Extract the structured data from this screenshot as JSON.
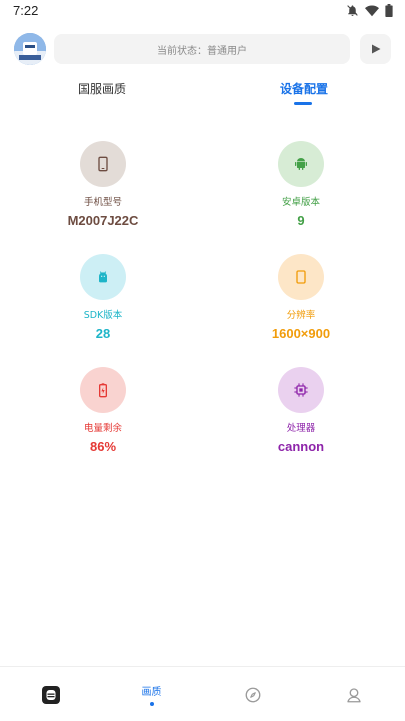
{
  "status_bar": {
    "time": "7:22"
  },
  "header": {
    "status_text": "当前状态：普通用户"
  },
  "tabs": [
    {
      "label": "国服画质",
      "active": false
    },
    {
      "label": "设备配置",
      "active": true
    }
  ],
  "device": {
    "items": [
      {
        "label": "手机型号",
        "value": "M2007J22C",
        "icon": "phone-icon",
        "color": "#6d4c41",
        "bg": "#e3dcd7"
      },
      {
        "label": "安卓版本",
        "value": "9",
        "icon": "android-icon",
        "color": "#43a047",
        "bg": "#d7ecd5"
      },
      {
        "label": "SDK版本",
        "value": "28",
        "icon": "android-head-icon",
        "color": "#1eb5c8",
        "bg": "#cdeff5"
      },
      {
        "label": "分辨率",
        "value": "1600×900",
        "icon": "screen-icon",
        "color": "#f19c0a",
        "bg": "#fde6c7"
      },
      {
        "label": "电量剩余",
        "value": "86%",
        "icon": "battery-icon",
        "color": "#e53935",
        "bg": "#f9d3d0"
      },
      {
        "label": "处理器",
        "value": "cannon",
        "icon": "cpu-icon",
        "color": "#8e24aa",
        "bg": "#ead1ef"
      }
    ]
  },
  "bottom_nav": {
    "items": [
      {
        "icon": "app-logo-icon",
        "label": ""
      },
      {
        "icon": "",
        "label": "画质"
      },
      {
        "icon": "compass-icon",
        "label": ""
      },
      {
        "icon": "profile-icon",
        "label": ""
      }
    ]
  },
  "colors": {
    "accent": "#1a73e8"
  }
}
